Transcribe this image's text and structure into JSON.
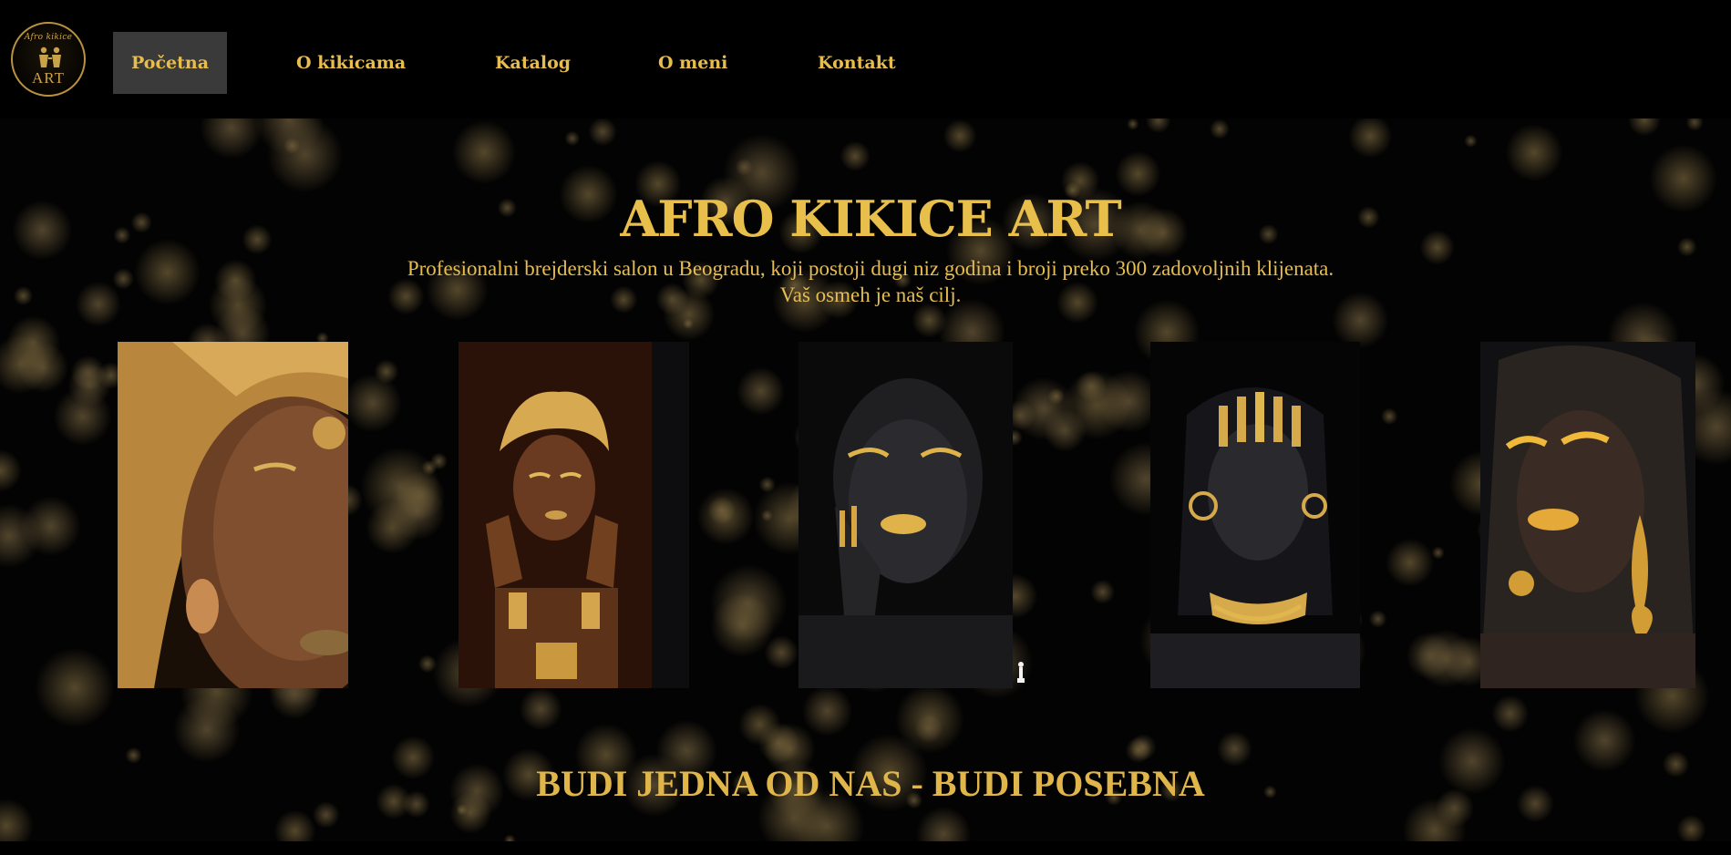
{
  "logo": {
    "script_text": "Afro kikice",
    "art_text": "ART"
  },
  "nav": {
    "items": [
      {
        "label": "Početna",
        "active": true
      },
      {
        "label": "O kikicama",
        "active": false
      },
      {
        "label": "Katalog",
        "active": false
      },
      {
        "label": "O meni",
        "active": false
      },
      {
        "label": "Kontakt",
        "active": false
      }
    ]
  },
  "hero": {
    "title": "AFRO KIKICE ART",
    "subtitle_line1": "Profesionalni brejderski salon u Beogradu, koji postoji dugi niz godina i broji preko 300 zadovoljnih klijenata.",
    "subtitle_line2": "Vaš osmeh je naš cilj."
  },
  "gallery": {
    "images": [
      {
        "alt": "woman-gold-headwrap-closeup"
      },
      {
        "alt": "woman-gold-turban-hands"
      },
      {
        "alt": "woman-black-paint-gold-lips"
      },
      {
        "alt": "woman-braids-gold-jewelry"
      },
      {
        "alt": "woman-gold-earrings-eyes-closed"
      }
    ]
  },
  "tagline": "BUDI JEDNA OD NAS - BUDI POSEBNA",
  "colors": {
    "accent_gold": "#e9bf4b",
    "background": "#000000",
    "nav_active_bg": "#3a3a3a"
  }
}
